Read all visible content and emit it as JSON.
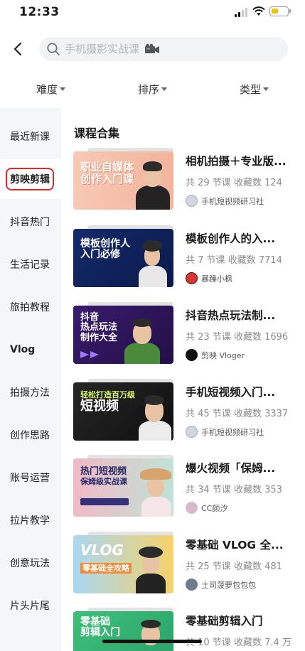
{
  "status_bar": {
    "time": "12:33"
  },
  "search": {
    "placeholder": "手机摄影实战课"
  },
  "filters": [
    "难度",
    "排序",
    "类型"
  ],
  "sidebar": {
    "items": [
      {
        "label": "最近新课"
      },
      {
        "label": "剪映剪辑",
        "active": true
      },
      {
        "label": "抖音热门"
      },
      {
        "label": "生活记录"
      },
      {
        "label": "旅拍教程"
      },
      {
        "label": "Vlog"
      },
      {
        "label": "拍摄方法"
      },
      {
        "label": "创作思路"
      },
      {
        "label": "账号运营"
      },
      {
        "label": "拉片教学"
      },
      {
        "label": "创意玩法"
      },
      {
        "label": "片头片尾"
      }
    ]
  },
  "main": {
    "section_title": "课程合集",
    "courses": [
      {
        "title": "相机拍摄＋专业版...",
        "meta": "共 29 节课  收藏数 124",
        "author": "手机短视频研习社",
        "thumb_text": "职业自媒体\n创作入门课"
      },
      {
        "title": "模板创作人的入...",
        "meta": "共 7 节课  收藏数 7714",
        "author": "暴躁小枫",
        "thumb_text": "模板创作人\n入门必修"
      },
      {
        "title": "抖音热点玩法制...",
        "meta": "共 23 节课  收藏数 1696",
        "author": "剪映 Vloger",
        "thumb_text": "抖音\n热点玩法\n制作大全"
      },
      {
        "title": "手机短视频入门...",
        "meta": "共 45 节课  收藏数 3337",
        "author": "手机短视频研习社",
        "thumb_text": "轻松打造百万级\n短视频"
      },
      {
        "title": "爆火视频「保姆...",
        "meta": "共 34 节课  收藏数 353",
        "author": "CC颜汐",
        "thumb_text": "热门短视频\n保姆级实战课"
      },
      {
        "title": "零基础 VLOG 全...",
        "meta": "共 25 节课  收藏数 481",
        "author": "土司菠萝包包包",
        "thumb_text": "VLOG\n零基础全攻略"
      },
      {
        "title": "零基础剪辑入门",
        "meta": "共 10 节课  收藏数 7.4 万",
        "author": "",
        "thumb_text": "零基础\n剪辑入门"
      }
    ]
  },
  "colors": {
    "active_outline": "#e6262d",
    "sidebar_bg": "#f5f6f8",
    "search_bg": "#f2f3f5"
  }
}
